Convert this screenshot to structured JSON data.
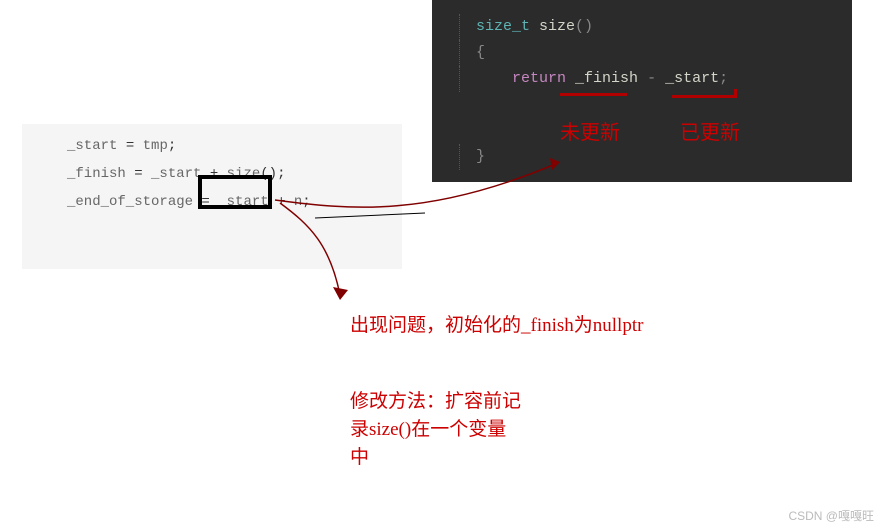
{
  "light_code": {
    "line1_lhs": "_start",
    "line1_op": " = ",
    "line1_rhs": "tmp",
    "line1_semi": ";",
    "line2_lhs": "_finish",
    "line2_op": " = ",
    "line2_rhs1": "_start",
    "line2_plus": " + ",
    "line2_call": "size",
    "line2_parens": "();",
    "line3_lhs": "_end_of_storage",
    "line3_op": " = ",
    "line3_rhs1": "_start",
    "line3_plus": " + ",
    "line3_rhs2": "n",
    "line3_semi": ";"
  },
  "dark_code": {
    "type_kw": "size_t",
    "func_name": " size",
    "parens": "()",
    "open_brace": "{",
    "return_kw": "return",
    "space": " ",
    "var1": "_finish",
    "minus": " - ",
    "var2": "_start",
    "semi": ";",
    "close_brace": "}"
  },
  "labels": {
    "not_updated": "未更新",
    "updated": "已更新"
  },
  "annotations": {
    "problem": "出现问题，初始化的_finish为nullptr",
    "fix_l1": "修改方法：扩容前记",
    "fix_l2": "录size()在一个变量",
    "fix_l3": "中"
  },
  "watermark": "CSDN @嘎嘎旺"
}
